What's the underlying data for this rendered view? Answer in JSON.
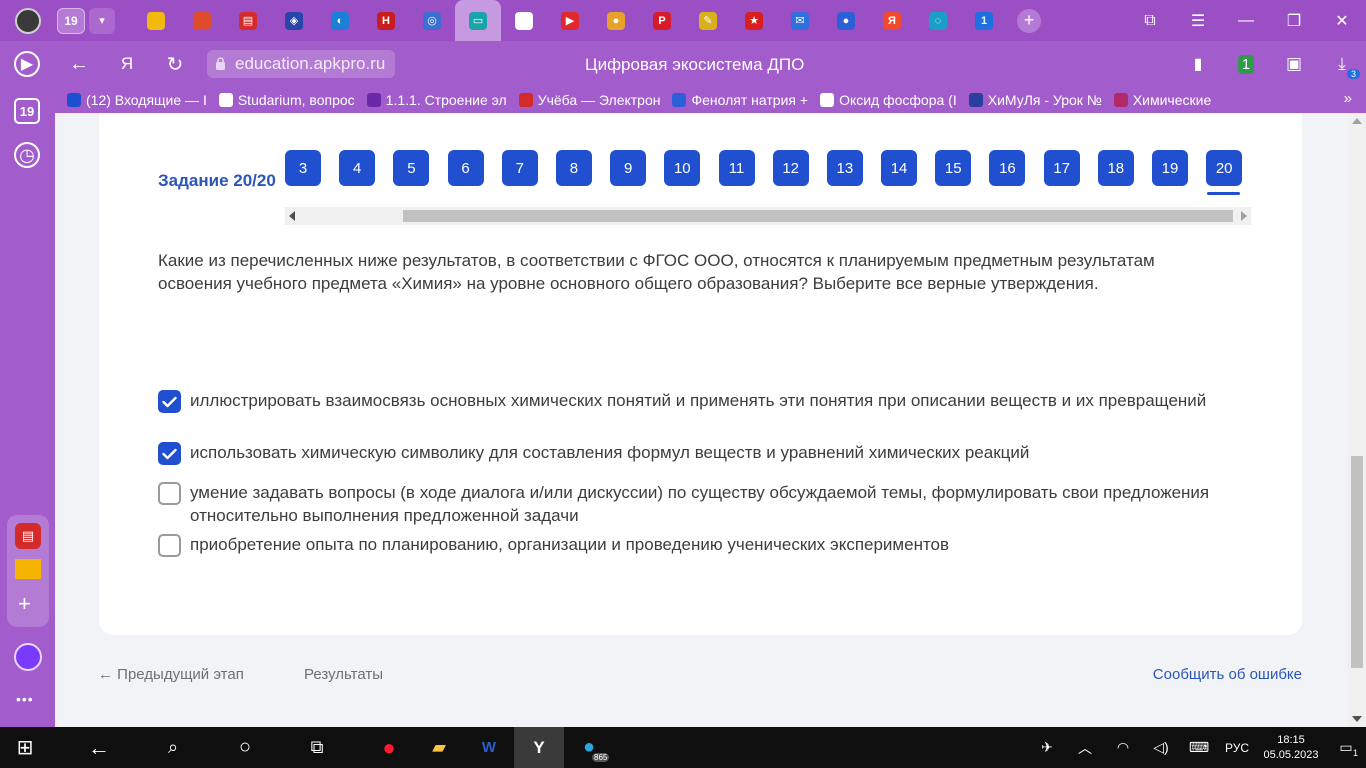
{
  "browser": {
    "tab_count": "19",
    "url": "education.apkpro.ru",
    "page_title": "Цифровая экосистема ДПО",
    "downloads_count": "3",
    "ext_badge": "1"
  },
  "pinned_tabs": [
    {
      "name": "pinned-tab-windows",
      "color": "#f2b90f",
      "glyph": ""
    },
    {
      "name": "pinned-tab-microsoft",
      "color": "#e04a2c",
      "glyph": ""
    },
    {
      "name": "pinned-tab-notes",
      "color": "#d42a2a",
      "glyph": "▤"
    },
    {
      "name": "pinned-tab-shield",
      "color": "#2846a8",
      "glyph": "◈"
    },
    {
      "name": "pinned-tab-edge",
      "color": "#1b7fd6",
      "glyph": "◐"
    },
    {
      "name": "pinned-tab-n",
      "color": "#c91c1c",
      "glyph": "Н"
    },
    {
      "name": "pinned-tab-owl",
      "color": "#3b6fd1",
      "glyph": "◎"
    },
    {
      "name": "pinned-tab-book",
      "color": "#1aa4a8",
      "glyph": "▭"
    },
    {
      "name": "pinned-tab-document",
      "color": "#ffffff",
      "glyph": ""
    },
    {
      "name": "pinned-tab-video",
      "color": "#e0282f",
      "glyph": "▶"
    },
    {
      "name": "pinned-tab-chrome",
      "color": "#e8a12b",
      "glyph": "●"
    },
    {
      "name": "pinned-tab-pinterest",
      "color": "#d61c2a",
      "glyph": "P"
    },
    {
      "name": "pinned-tab-hammer",
      "color": "#d9b21b",
      "glyph": "✎"
    },
    {
      "name": "pinned-tab-star",
      "color": "#d81e1e",
      "glyph": "★"
    },
    {
      "name": "pinned-tab-mail",
      "color": "#2f6fe0",
      "glyph": "✉"
    },
    {
      "name": "pinned-tab-russia",
      "color": "#2d5fd6",
      "glyph": "●"
    },
    {
      "name": "pinned-tab-yandex",
      "color": "#f04a2c",
      "glyph": "Я"
    },
    {
      "name": "pinned-tab-wave",
      "color": "#1aa0c8",
      "glyph": "◌"
    },
    {
      "name": "pinned-tab-one",
      "color": "#1e6fe0",
      "glyph": "1"
    }
  ],
  "bookmarks": [
    {
      "label": "(12) Входящие — I",
      "color": "#1c4fcf"
    },
    {
      "label": "Studarium, вопрос",
      "color": "#ffffff"
    },
    {
      "label": "1.1.1. Строение эл",
      "color": "#6a2aa8"
    },
    {
      "label": "Учёба — Электрон",
      "color": "#d42a2a"
    },
    {
      "label": "Фенолят натрия +",
      "color": "#2d5fd6"
    },
    {
      "label": "Оксид фосфора (I",
      "color": "#ffffff"
    },
    {
      "label": "ХиМуЛя - Урок №",
      "color": "#2a3fa0"
    },
    {
      "label": "Химические",
      "color": "#b02a6a"
    }
  ],
  "side_panel": {
    "tabs_badge": "19"
  },
  "task": {
    "title": "Задание 20/20",
    "nav_numbers": [
      "3",
      "4",
      "5",
      "6",
      "7",
      "8",
      "9",
      "10",
      "11",
      "12",
      "13",
      "14",
      "15",
      "16",
      "17",
      "18",
      "19",
      "20"
    ],
    "question": "Какие из перечисленных ниже результатов, в соответствии с ФГОС ООО, относятся к планируемым предметным результатам освоения учебного предмета «Химия» на уровне основного общего образования? Выберите все верные утверждения.",
    "options": [
      {
        "text": "иллюстрировать взаимосвязь основных химических понятий и применять эти понятия при описании веществ и их превращений",
        "checked": true
      },
      {
        "text": "использовать химическую символику для составления формул веществ и уравнений химических реакций",
        "checked": true
      },
      {
        "text": "умение задавать вопросы (в ходе диалога и/или дискуссии) по существу обсуждаемой темы, формулировать свои предложения относительно выполнения предложенной задачи",
        "checked": false
      },
      {
        "text": "приобретение опыта по планированию, организации и проведению ученических экспериментов",
        "checked": false
      }
    ]
  },
  "footer": {
    "prev": "← Предыдущий этап",
    "results": "Результаты",
    "report": "Сообщить об ошибке"
  },
  "taskbar": {
    "lang": "РУС",
    "time": "18:15",
    "date": "05.05.2023",
    "notifications": "1",
    "telegram_badge": "865"
  },
  "colors": {
    "accent": "#2050cf",
    "chrome": "#a35ccb"
  }
}
